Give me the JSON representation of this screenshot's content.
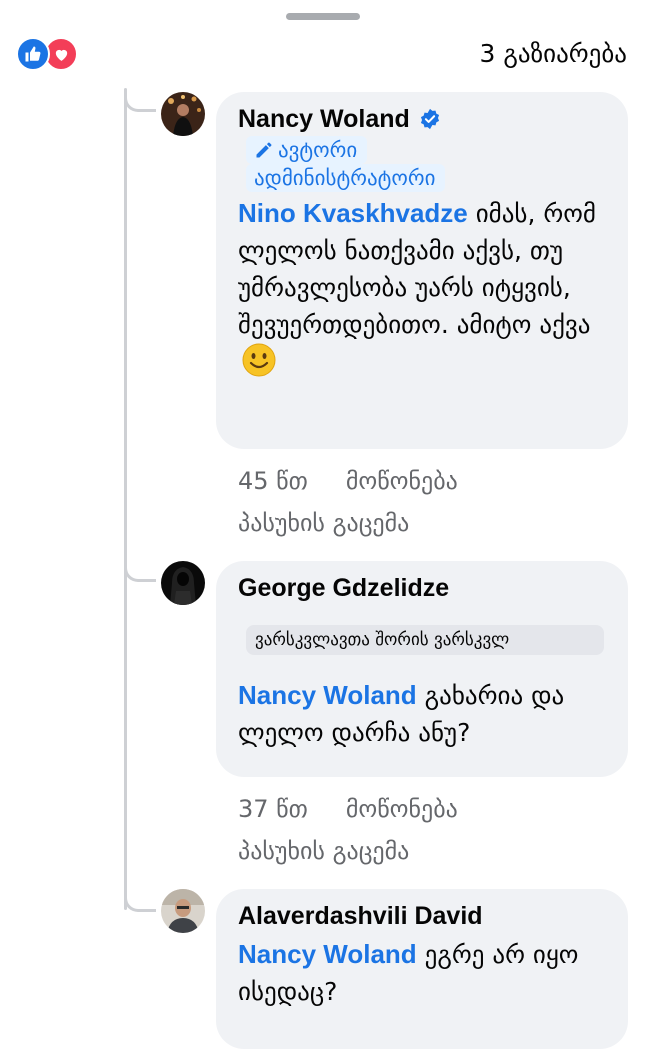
{
  "sheet": {
    "share_count": "3 გაზიარება",
    "reaction_icons": [
      "like-icon",
      "love-icon"
    ]
  },
  "comments": [
    {
      "author": "Nancy Woland",
      "verified": true,
      "badge_icon": "pencil-icon",
      "badge_line1": "ავტორი",
      "badge_line2": "ადმინისტრატორი",
      "mention": "Nino Kvaskhvadze",
      "text": "იმას, რომ ლელოს ნათქვამი აქვს, თუ უმრავლესობა უარს იტყვის, შევუერთდებითო. ამიტო აქვა",
      "emoji": "smiling-face-icon",
      "time": "45 წთ",
      "like_label": "მოწონება",
      "reply_label": "პასუხის გაცემა"
    },
    {
      "author": "George Gdzelidze",
      "tag": "ვარსკვლავთა შორის ვარსკვლ",
      "mention": "Nancy Woland",
      "text": "გახარია და ლელო დარჩა ანუ?",
      "time": "37 წთ",
      "like_label": "მოწონება",
      "reply_label": "პასუხის გაცემა"
    },
    {
      "author": "Alaverdashvili David",
      "mention": "Nancy Woland",
      "text": "ეგრე არ იყო ისედაც?"
    }
  ],
  "colors": {
    "link_blue": "#1b74e4",
    "bubble_bg": "#f0f2f5",
    "meta_gray": "#65676b",
    "thread_line": "#ced0d4",
    "love_red": "#f33e58"
  }
}
